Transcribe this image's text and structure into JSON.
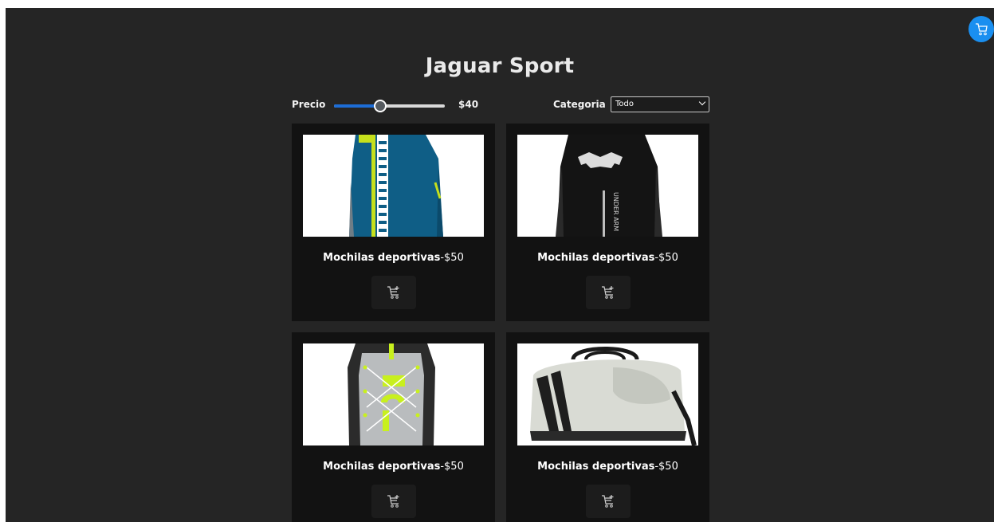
{
  "header": {
    "title": "Jaguar Sport"
  },
  "filters": {
    "price_label": "Precio",
    "price_value": "$40",
    "price_fraction": 0.42,
    "category_label": "Categoria",
    "category_selected": "Todo"
  },
  "products": [
    {
      "name": "Mochilas deportivas",
      "price": "-$50"
    },
    {
      "name": "Mochilas deportivas",
      "price": "-$50"
    },
    {
      "name": "Mochilas deportivas",
      "price": "-$50"
    },
    {
      "name": "Mochilas deportivas",
      "price": "-$50"
    }
  ],
  "icons": {
    "cart": "cart-icon",
    "add_to_cart": "cart-plus-icon",
    "dropdown": "chevron-down-icon"
  },
  "colors": {
    "accent": "#1a8ff0",
    "slider_fill": "#1d6dd6",
    "background": "#252525",
    "card": "#121212"
  }
}
